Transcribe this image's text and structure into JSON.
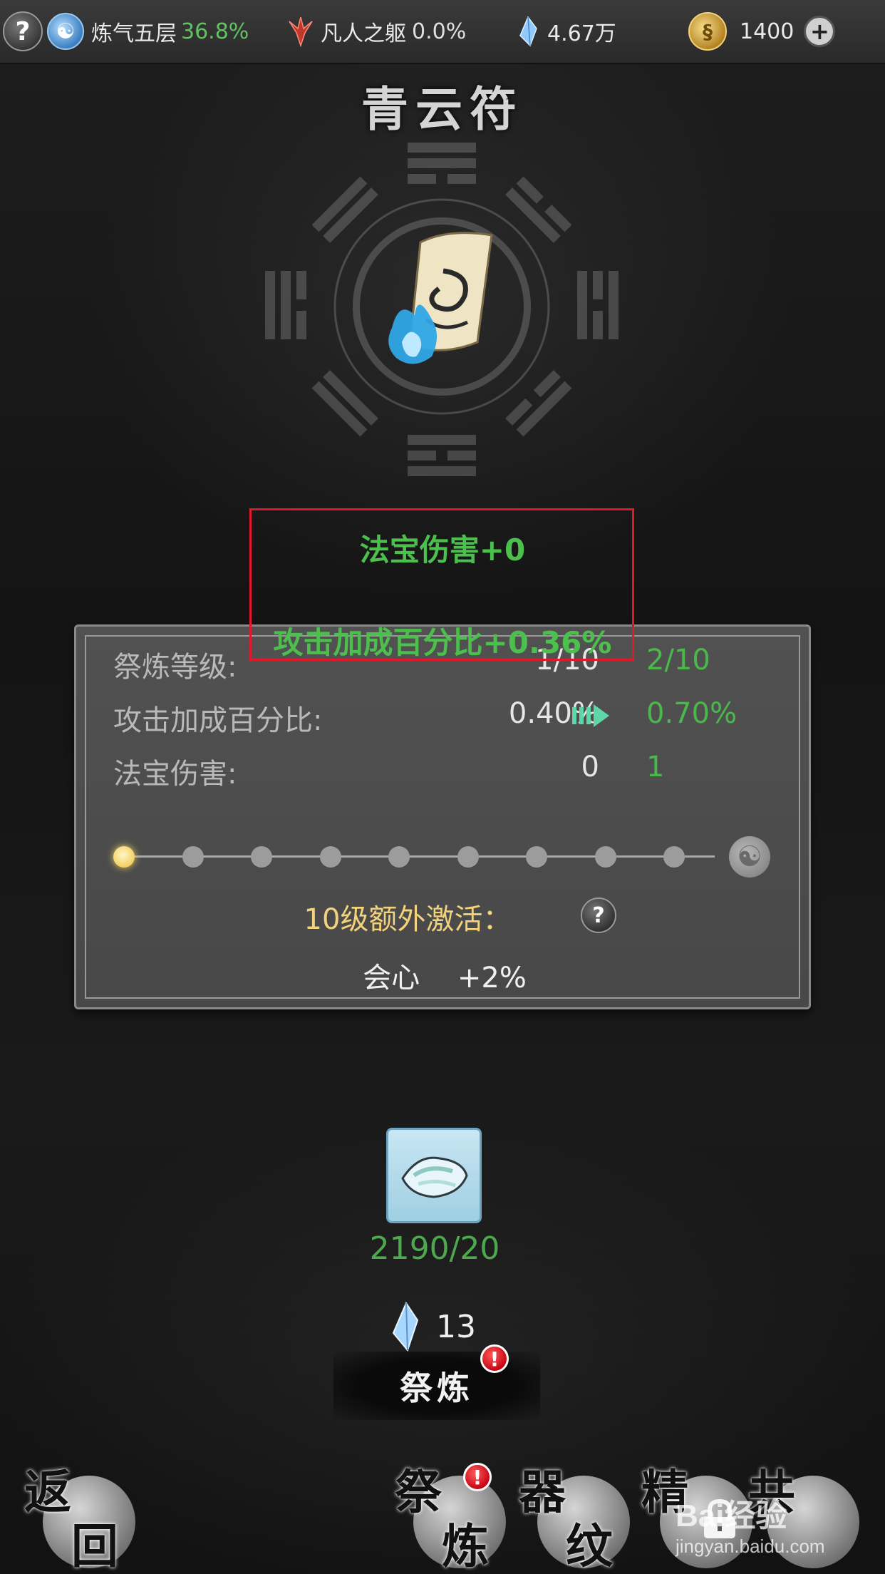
{
  "topbar": {
    "help": "?",
    "cultivation": {
      "label": "炼气五层",
      "percent": "36.8%"
    },
    "body": {
      "label": "凡人之躯",
      "percent": "0.0%"
    },
    "crystals": "4.67万",
    "coins": "1400",
    "plus": "+"
  },
  "item": {
    "title": "青云符"
  },
  "highlight": {
    "line1": "法宝伤害+0",
    "line2": "攻击加成百分比+0.36%"
  },
  "stats": {
    "rows": [
      {
        "label": "祭炼等级:",
        "current": "1/10",
        "next": "2/10"
      },
      {
        "label": "攻击加成百分比:",
        "current": "0.40%",
        "next": "0.70%"
      },
      {
        "label": "法宝伤害:",
        "current": "0",
        "next": "1"
      }
    ],
    "level_track": {
      "current": 1,
      "max": 10
    },
    "extra": {
      "label": "10级额外激活：",
      "help": "?",
      "stat_name": "会心",
      "stat_value": "+2%"
    }
  },
  "material": {
    "count": "2190/20"
  },
  "cost": {
    "amount": "13"
  },
  "refine_button": {
    "label": "祭炼",
    "badge": "!"
  },
  "bottom_nav": {
    "back": {
      "c1": "返",
      "c2": "回"
    },
    "refine": {
      "c1": "祭",
      "c2": "炼",
      "badge": "!"
    },
    "pattern": {
      "c1": "器",
      "c2": "纹"
    },
    "essence": {
      "c1": "精"
    },
    "resonance": {
      "c1": "共"
    }
  },
  "watermark": {
    "brand": "Bai经验",
    "url": "jingyan.baidu.com"
  },
  "colors": {
    "green": "#4cc04c",
    "gold": "#f2d27a",
    "highlight_border": "#e0192a",
    "badge_red": "#c40010"
  }
}
